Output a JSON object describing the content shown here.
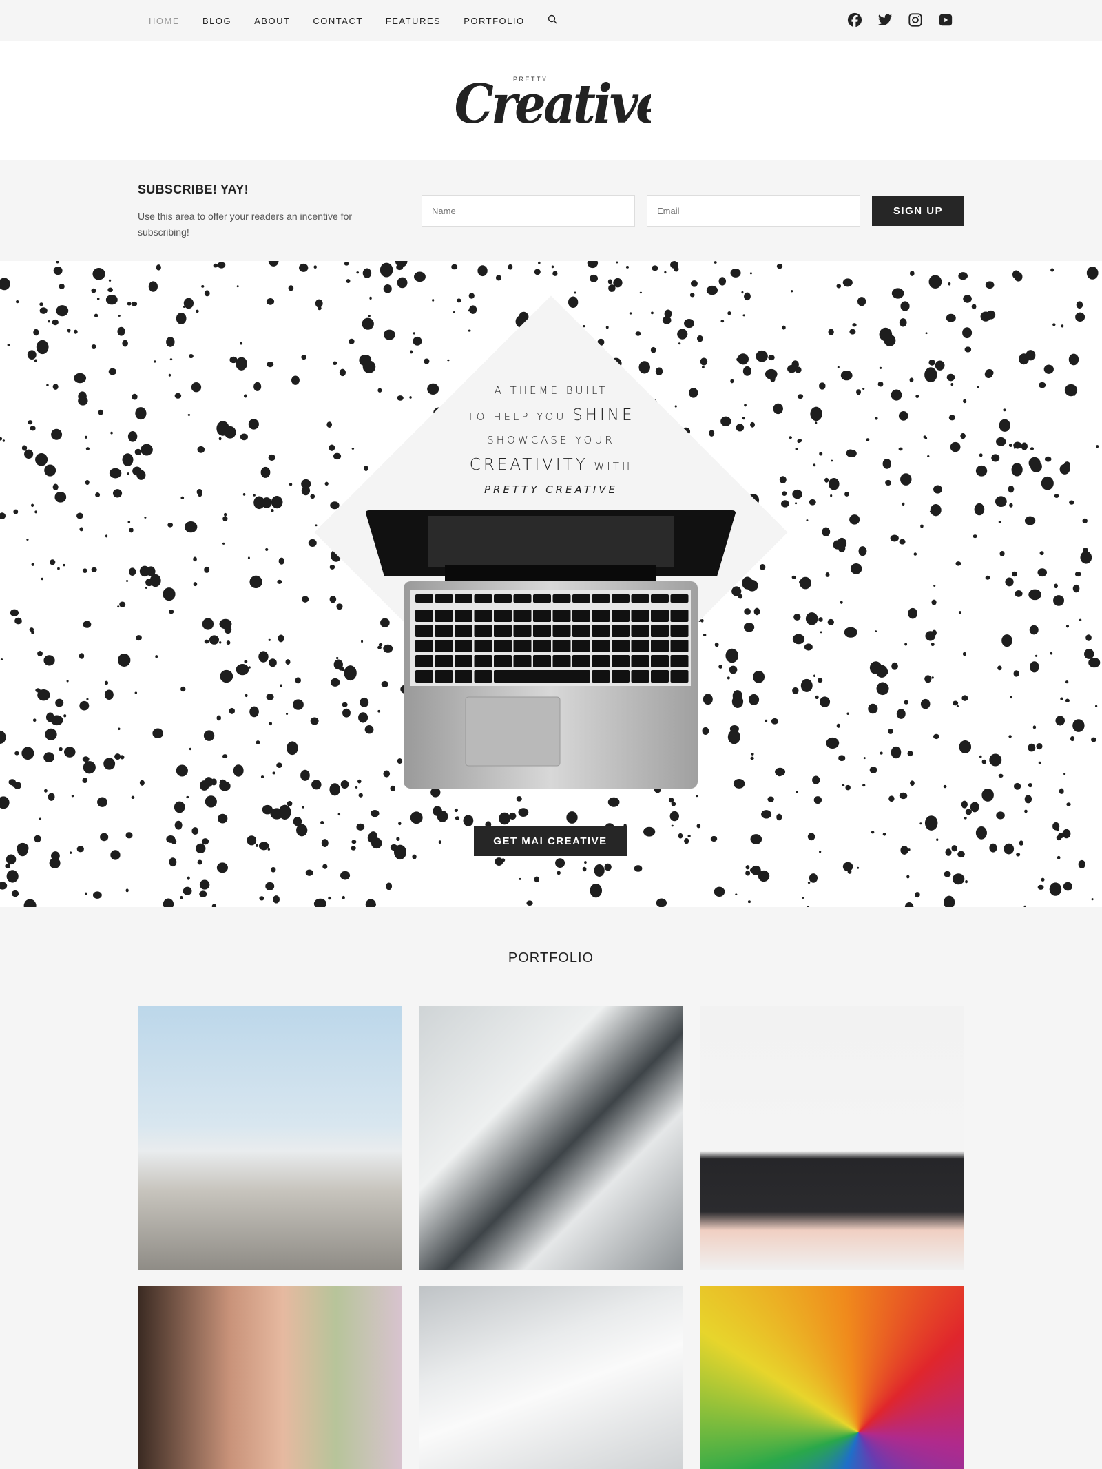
{
  "nav": {
    "items": [
      {
        "label": "HOME",
        "active": true
      },
      {
        "label": "BLOG"
      },
      {
        "label": "ABOUT"
      },
      {
        "label": "CONTACT"
      },
      {
        "label": "FEATURES"
      },
      {
        "label": "PORTFOLIO"
      }
    ],
    "search_icon": "search-icon",
    "social": [
      "facebook-icon",
      "twitter-icon",
      "instagram-icon",
      "youtube-icon"
    ]
  },
  "logo": {
    "small": "PRETTY",
    "main": "Creative"
  },
  "subscribe": {
    "title": "SUBSCRIBE! YAY!",
    "text": "Use this area to offer your readers an incentive for subscribing!",
    "name_placeholder": "Name",
    "email_placeholder": "Email",
    "button": "SIGN UP"
  },
  "hero": {
    "line1": "A THEME BUILT",
    "line2a": "TO HELP YOU",
    "line2b": "SHINE",
    "line3": "SHOWCASE YOUR",
    "line4a": "CREATIVITY",
    "line4b": "WITH",
    "line5": "PRETTY CREATIVE",
    "button": "GET MAI CREATIVE"
  },
  "portfolio": {
    "title": "PORTFOLIO",
    "items": [
      "santorini",
      "desk-collage",
      "keyboard-desk",
      "woman-sunglasses",
      "tablet-coffee",
      "colored-pencils"
    ]
  },
  "colors": {
    "dark": "#262626",
    "bg": "#f5f5f5",
    "active_nav": "#999999"
  }
}
